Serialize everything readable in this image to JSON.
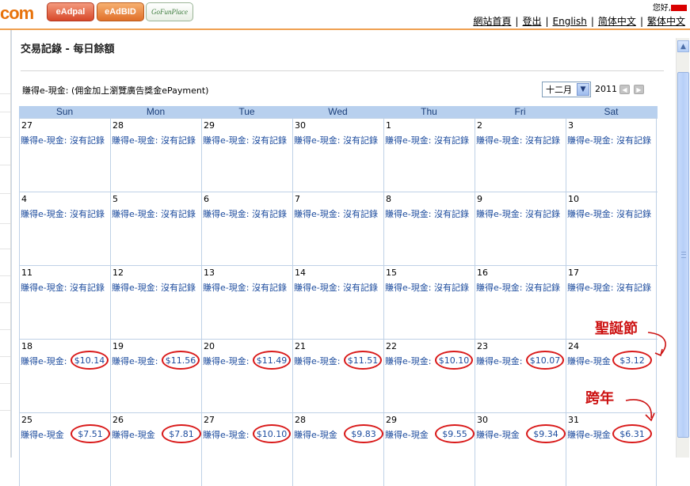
{
  "header": {
    "logo_fragment": "com",
    "brands": [
      "eAdpal",
      "eAdBID",
      "GoFunPlace"
    ],
    "greeting": "您好,",
    "links": [
      "網站首頁",
      "登出",
      "English",
      "简体中文",
      "繁体中文"
    ]
  },
  "panel": {
    "title": "交易記錄 - 每日餘額",
    "subtitle": "賺得e-現金: (佣金加上瀏覽廣告獎金ePayment)",
    "month": "十二月",
    "year": "2011",
    "prev_icon": "chevron-left-icon",
    "next_icon": "chevron-right-icon"
  },
  "calendar": {
    "weekdays": [
      "Sun",
      "Mon",
      "Tue",
      "Wed",
      "Thu",
      "Fri",
      "Sat"
    ],
    "label_prefix": "賺得e-現金:",
    "label_prefix_short": "賺得e-現金",
    "no_record": "賺得e-現金: 沒有記錄",
    "weeks": [
      [
        {
          "d": "27",
          "v": null
        },
        {
          "d": "28",
          "v": null
        },
        {
          "d": "29",
          "v": null
        },
        {
          "d": "30",
          "v": null
        },
        {
          "d": "1",
          "v": null
        },
        {
          "d": "2",
          "v": null
        },
        {
          "d": "3",
          "v": null
        }
      ],
      [
        {
          "d": "4",
          "v": null
        },
        {
          "d": "5",
          "v": null
        },
        {
          "d": "6",
          "v": null
        },
        {
          "d": "7",
          "v": null
        },
        {
          "d": "8",
          "v": null
        },
        {
          "d": "9",
          "v": null
        },
        {
          "d": "10",
          "v": null
        }
      ],
      [
        {
          "d": "11",
          "v": null
        },
        {
          "d": "12",
          "v": null
        },
        {
          "d": "13",
          "v": null
        },
        {
          "d": "14",
          "v": null
        },
        {
          "d": "15",
          "v": null
        },
        {
          "d": "16",
          "v": null
        },
        {
          "d": "17",
          "v": null
        }
      ],
      [
        {
          "d": "18",
          "v": "$10.14"
        },
        {
          "d": "19",
          "v": "$11.56"
        },
        {
          "d": "20",
          "v": "$11.49"
        },
        {
          "d": "21",
          "v": "$11.51"
        },
        {
          "d": "22",
          "v": "$10.10"
        },
        {
          "d": "23",
          "v": "$10.07"
        },
        {
          "d": "24",
          "v": "$3.12"
        }
      ],
      [
        {
          "d": "25",
          "v": "$7.51"
        },
        {
          "d": "26",
          "v": "$7.81"
        },
        {
          "d": "27",
          "v": "$10.10"
        },
        {
          "d": "28",
          "v": "$9.83"
        },
        {
          "d": "29",
          "v": "$9.55"
        },
        {
          "d": "30",
          "v": "$9.34"
        },
        {
          "d": "31",
          "v": "$6.31"
        }
      ]
    ]
  },
  "annotations": {
    "christmas": "聖誕節",
    "new_year": "跨年",
    "color": "#cc1111"
  }
}
